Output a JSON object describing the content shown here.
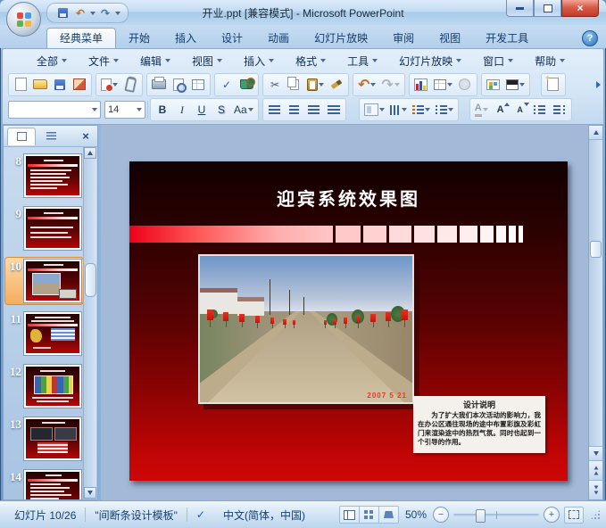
{
  "window": {
    "title": "开业.ppt [兼容模式] - Microsoft PowerPoint"
  },
  "ribbon": {
    "tabs": [
      "经典菜单",
      "开始",
      "插入",
      "设计",
      "动画",
      "幻灯片放映",
      "审阅",
      "视图",
      "开发工具"
    ],
    "active_tab": "经典菜单"
  },
  "menu_bar": {
    "items": [
      "全部",
      "文件",
      "编辑",
      "视图",
      "插入",
      "格式",
      "工具",
      "幻灯片放映",
      "窗口",
      "帮助"
    ]
  },
  "formatting": {
    "font_name": "",
    "font_size": "14"
  },
  "slide_panel": {
    "slides": [
      "8",
      "9",
      "10",
      "11",
      "12",
      "13",
      "14"
    ],
    "selected": "10"
  },
  "slide": {
    "title": "迎宾系统效果图",
    "photo_date": "2007 5 21",
    "note_title": "设计说明",
    "note_body": "为了扩大我们本次活动的影响力，我在办公区通往现场的途中布置彩旗及彩虹门来渲染途中的热烈气氛。同时也起到一个引导的作用。"
  },
  "status_bar": {
    "slide_indicator": "幻灯片 10/26",
    "template_name": "\"间断条设计模板\"",
    "language": "中文(简体，中国)",
    "zoom_level": "50%"
  },
  "icons": {
    "help": "?",
    "close": "×",
    "undo": "↶",
    "redo": "↷",
    "cut": "✂",
    "check": "✓",
    "bold": "B",
    "italic": "I",
    "underline": "U",
    "shadow": "S",
    "case": "Aa",
    "font_a": "A"
  },
  "colors": {
    "slide_red": "#cc0606",
    "slide_dark": "#120000",
    "selection_orange": "#f5ad5e",
    "frame_blue": "#7ba6d6"
  }
}
